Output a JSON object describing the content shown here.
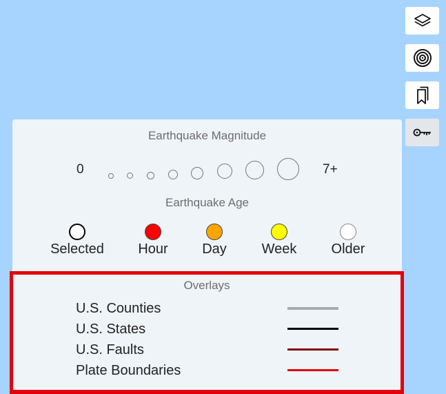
{
  "controls": [
    {
      "id": "layers",
      "icon": "layers-icon"
    },
    {
      "id": "target",
      "icon": "concentric-circles-icon"
    },
    {
      "id": "bookmarks",
      "icon": "bookmarks-icon"
    },
    {
      "id": "legend",
      "icon": "key-icon",
      "active": true
    }
  ],
  "legend": {
    "magnitude": {
      "title": "Earthquake Magnitude",
      "min_label": "0",
      "max_label": "7+"
    },
    "age": {
      "title": "Earthquake Age",
      "items": [
        {
          "label": "Selected",
          "color": "#ffffff",
          "border": "#000000"
        },
        {
          "label": "Hour",
          "color": "#ff0000",
          "border": "#333333"
        },
        {
          "label": "Day",
          "color": "#ffa500",
          "border": "#333333"
        },
        {
          "label": "Week",
          "color": "#ffff00",
          "border": "#333333"
        },
        {
          "label": "Older",
          "color": "#ffffff",
          "border": "#888888"
        }
      ]
    },
    "overlays": {
      "title": "Overlays",
      "items": [
        {
          "label": "U.S. Counties",
          "color": "#aaaaaa"
        },
        {
          "label": "U.S. States",
          "color": "#000000"
        },
        {
          "label": "U.S. Faults",
          "color": "#800000"
        },
        {
          "label": "Plate Boundaries",
          "color": "#e00000"
        }
      ]
    }
  },
  "colors": {
    "map_background": "#a6d4ff",
    "panel_background": "#eff4f9",
    "highlight_border": "#e3000b"
  }
}
